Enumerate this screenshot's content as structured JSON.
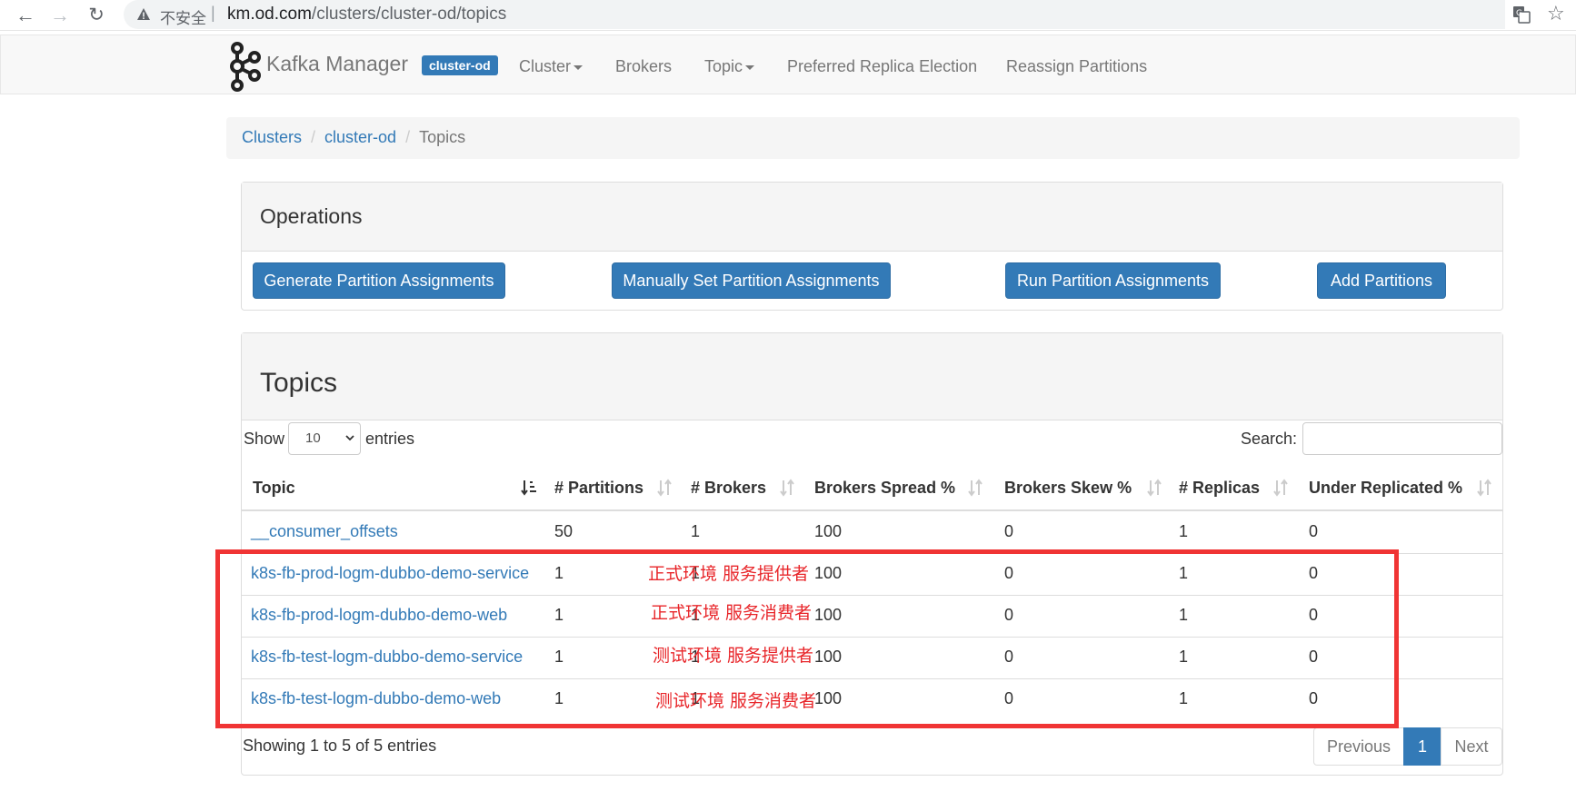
{
  "browser": {
    "insecure_label": "不安全",
    "url_host": "km.od.com",
    "url_path": "/clusters/cluster-od/topics",
    "icons": [
      "back-icon",
      "forward-icon",
      "reload-icon",
      "warning-icon",
      "translate-icon",
      "star-icon"
    ]
  },
  "navbar": {
    "brand": "Kafka Manager",
    "cluster_badge": "cluster-od",
    "items": [
      "Cluster",
      "Brokers",
      "Topic",
      "Preferred Replica Election",
      "Reassign Partitions"
    ]
  },
  "breadcrumb": {
    "items": [
      "Clusters",
      "cluster-od",
      "Topics"
    ],
    "separator": "/"
  },
  "operations": {
    "title": "Operations",
    "buttons": [
      "Generate Partition Assignments",
      "Manually Set Partition Assignments",
      "Run Partition Assignments",
      "Add Partitions"
    ]
  },
  "topics": {
    "title": "Topics",
    "show_label": "Show",
    "page_size": "10",
    "entries_label": "entries",
    "search_label": "Search:",
    "columns": [
      "Topic",
      "# Partitions",
      "# Brokers",
      "Brokers Spread %",
      "Brokers Skew %",
      "# Replicas",
      "Under Replicated %"
    ],
    "rows": [
      {
        "topic": "__consumer_offsets",
        "partitions": "50",
        "brokers": "1",
        "spread": "100",
        "skew": "0",
        "replicas": "1",
        "under_replicated": "0"
      },
      {
        "topic": "k8s-fb-prod-logm-dubbo-demo-service",
        "partitions": "1",
        "brokers": "1",
        "spread": "100",
        "skew": "0",
        "replicas": "1",
        "under_replicated": "0"
      },
      {
        "topic": "k8s-fb-prod-logm-dubbo-demo-web",
        "partitions": "1",
        "brokers": "1",
        "spread": "100",
        "skew": "0",
        "replicas": "1",
        "under_replicated": "0"
      },
      {
        "topic": "k8s-fb-test-logm-dubbo-demo-service",
        "partitions": "1",
        "brokers": "1",
        "spread": "100",
        "skew": "0",
        "replicas": "1",
        "under_replicated": "0"
      },
      {
        "topic": "k8s-fb-test-logm-dubbo-demo-web",
        "partitions": "1",
        "brokers": "1",
        "spread": "100",
        "skew": "0",
        "replicas": "1",
        "under_replicated": "0"
      }
    ],
    "showing": "Showing 1 to 5 of 5 entries",
    "pager": {
      "previous": "Previous",
      "current": "1",
      "next": "Next"
    }
  },
  "annotations": [
    "正式环境 服务提供者",
    "正式环境 服务消费者",
    "测试环境 服务提供者",
    "测试环境 服务消费者"
  ],
  "colors": {
    "accent": "#337ab7",
    "annotation": "#f03434"
  }
}
